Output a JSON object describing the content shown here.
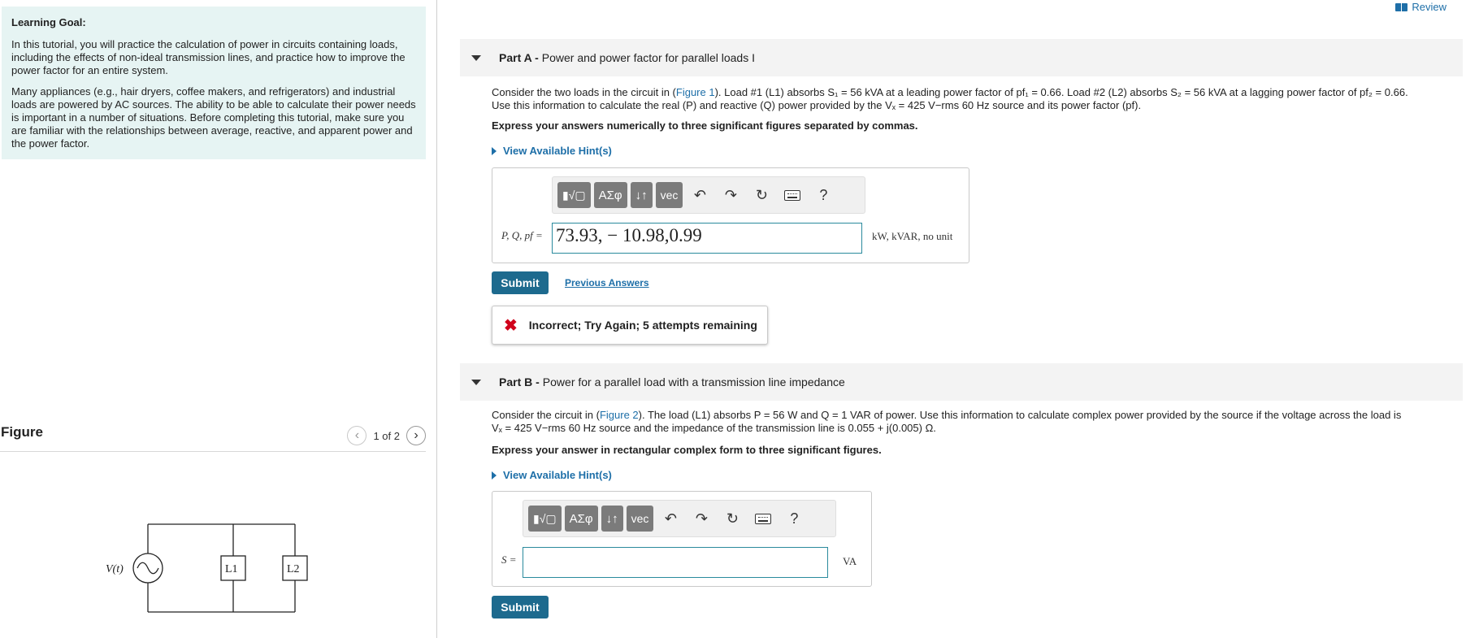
{
  "learning_goal": {
    "title": "Learning Goal:",
    "paragraph1": "In this tutorial, you will practice the calculation of power in circuits containing loads, including the effects of non-ideal transmission lines, and practice how to improve the power factor for an entire system.",
    "paragraph2": "Many appliances (e.g., hair dryers, coffee makers, and refrigerators) and industrial loads are powered by AC sources. The ability to be able to calculate their power needs is important in a number of situations. Before completing this tutorial, make sure you are familiar with the relationships between average, reactive, and apparent power and the power factor."
  },
  "figure": {
    "title": "Figure",
    "pager": "1 of 2",
    "source_label": "V(t)",
    "load1": "L1",
    "load2": "L2"
  },
  "review": {
    "label": "Review"
  },
  "part_a": {
    "label": "Part A -",
    "title": "Power and power factor for parallel loads I",
    "problem_1": "Consider the two loads in the circuit in (",
    "figure_link": "Figure 1",
    "problem_2": "). Load #1 (L1) absorbs S₁ = 56 kVA at a leading power factor of pf₁ = 0.66. Load #2 (L2) absorbs S₂ = 56 kVA at a lagging power factor of pf₂ = 0.66.",
    "problem_3": "Use this information to calculate the real (P) and reactive (Q) power provided by the Vₓ = 425 V−rms 60 Hz source and its power factor (pf).",
    "instruction": "Express your answers numerically to three significant figures separated by commas.",
    "hint": "View Available Hint(s)",
    "var_label": "P, Q, pf =",
    "answer_value": "73.93, − 10.98,0.99",
    "units": "kW, kVAR, no unit",
    "submit": "Submit",
    "previous": "Previous Answers",
    "feedback": "Incorrect; Try Again; 5 attempts remaining"
  },
  "part_b": {
    "label": "Part B -",
    "title": "Power for a parallel load with a transmission line impedance",
    "problem_1": "Consider the circuit in (",
    "figure_link": "Figure 2",
    "problem_2": "). The load (L1) absorbs P = 56 W and Q = 1 VAR of power. Use this information to calculate complex power provided by the source if the voltage across the load is",
    "problem_3": "Vₓ = 425 V−rms 60 Hz source and the impedance of the transmission line is 0.055 + j(0.005) Ω.",
    "instruction": "Express your answer in rectangular complex form to three significant figures.",
    "hint": "View Available Hint(s)",
    "var_label": "S =",
    "answer_value": "",
    "units": "VA",
    "submit": "Submit"
  },
  "toolbar": {
    "templates": "▮√▢",
    "greek": "ΑΣφ",
    "arrows": "↓↑",
    "vec": "vec",
    "help": "?"
  }
}
